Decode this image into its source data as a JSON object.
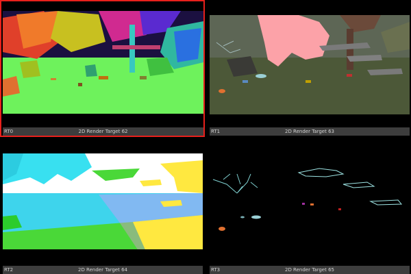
{
  "targets": [
    {
      "index": "RT0",
      "title": "2D Render Target 62",
      "selected": true
    },
    {
      "index": "RT1",
      "title": "2D Render Target 63",
      "selected": false
    },
    {
      "index": "RT2",
      "title": "2D Render Target 64",
      "selected": false
    },
    {
      "index": "RT3",
      "title": "2D Render Target 65",
      "selected": false
    }
  ],
  "colors": {
    "selection_border": "#e8201c",
    "caption_bg": "#3d3d3d",
    "caption_text": "#d4d4d4",
    "background": "#000000"
  }
}
